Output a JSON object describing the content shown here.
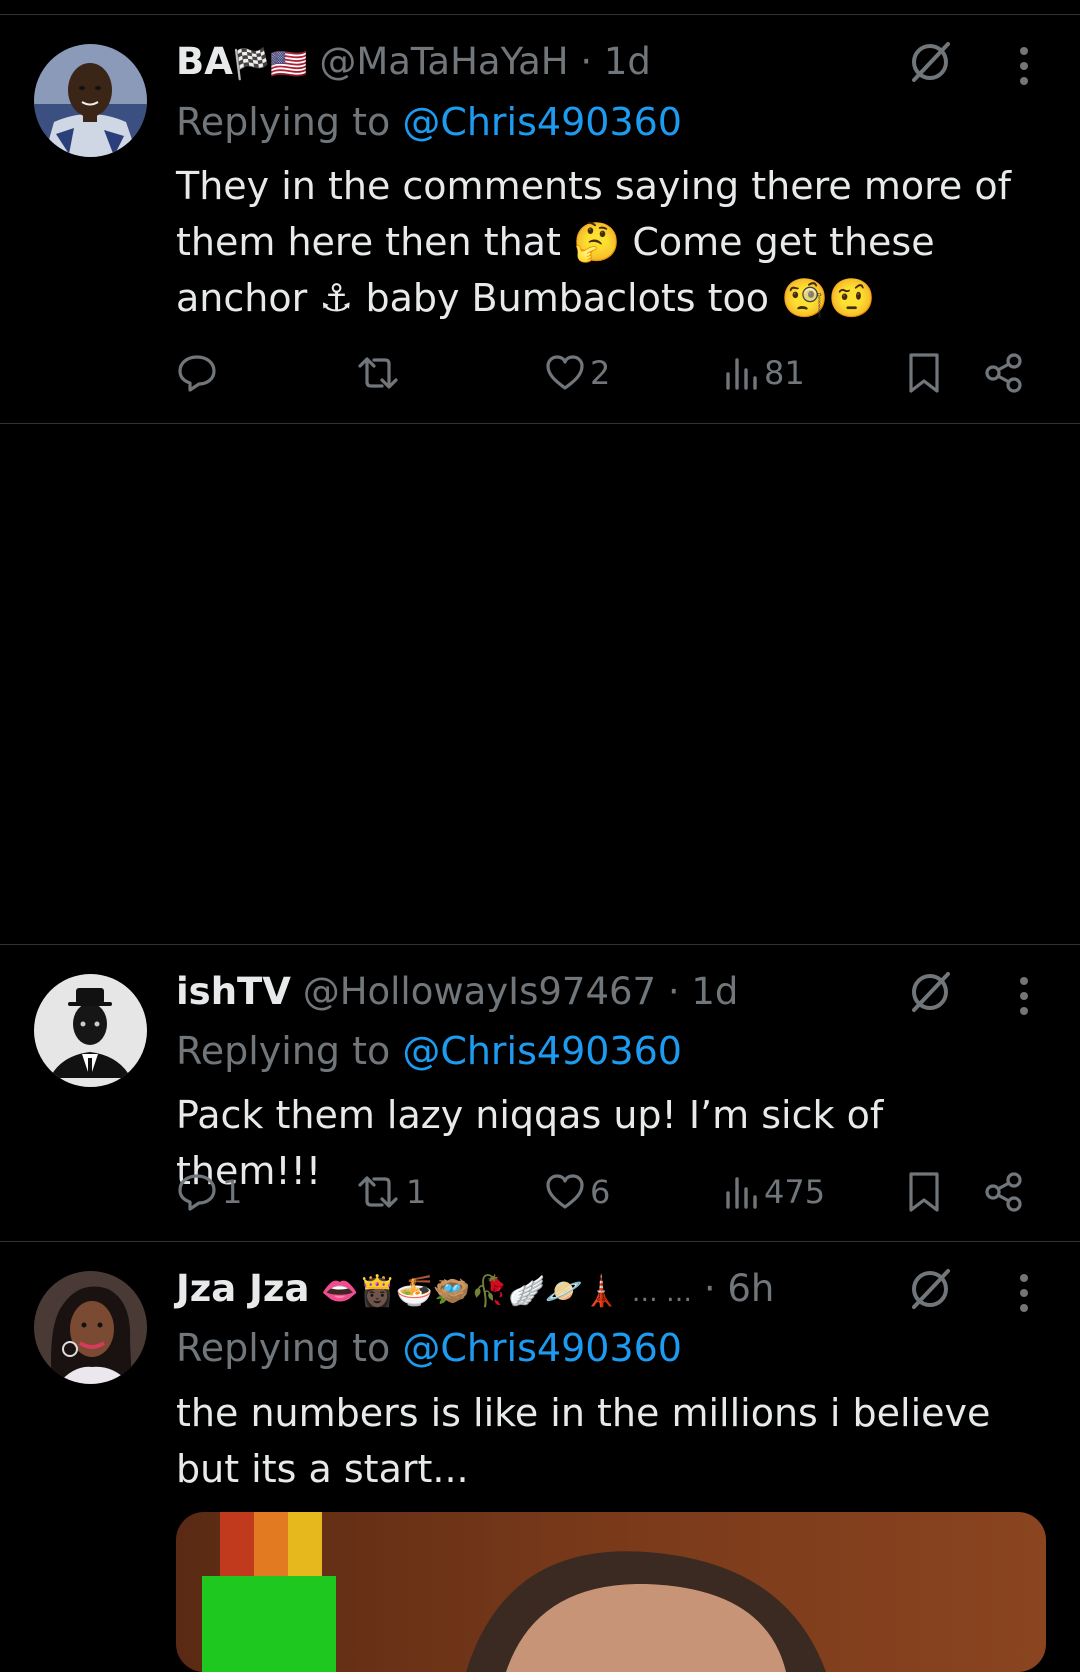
{
  "tweets": [
    {
      "display_name": "BA",
      "name_emoji": "🏁🇺🇸",
      "handle": "@MaTaHaYaH",
      "separator": "·",
      "time": "1d",
      "replying_prefix": "Replying to ",
      "replying_to": "@Chris490360",
      "body_lines": [
        "They in the comments saying there more of",
        "them here then that 🤔 Come get these",
        "anchor ⚓ baby Bumbaclots too 🧐🤨"
      ],
      "replies": "",
      "reposts": "",
      "likes": "2",
      "views": "81"
    },
    {
      "display_name": "ishTV",
      "handle": "@HollowayIs97467",
      "separator": "·",
      "time": "1d",
      "replying_prefix": "Replying to ",
      "replying_to": "@Chris490360",
      "body_lines": [
        "Pack them lazy niqqas up! I’m sick of them!!!"
      ],
      "replies": "1",
      "reposts": "1",
      "likes": "6",
      "views": "475"
    },
    {
      "display_name": "Jza Jza",
      "name_emoji": "👄👸🏿🍜🪺🥀🪽🪐🗼",
      "name_ellipsis": "… …",
      "separator": "·",
      "time": "6h",
      "replying_prefix": "Replying to ",
      "replying_to": "@Chris490360",
      "body_lines": [
        "the numbers is like in the millions i believe",
        "but its a start..."
      ]
    }
  ],
  "icons": [
    "grok-icon",
    "more-icon",
    "reply-icon",
    "repost-icon",
    "like-icon",
    "views-icon",
    "bookmark-icon",
    "share-icon"
  ],
  "colors": {
    "background": "#000000",
    "text": "#e7e9ea",
    "muted": "#71767b",
    "link": "#1d9bf0",
    "divider": "#2f3336"
  }
}
